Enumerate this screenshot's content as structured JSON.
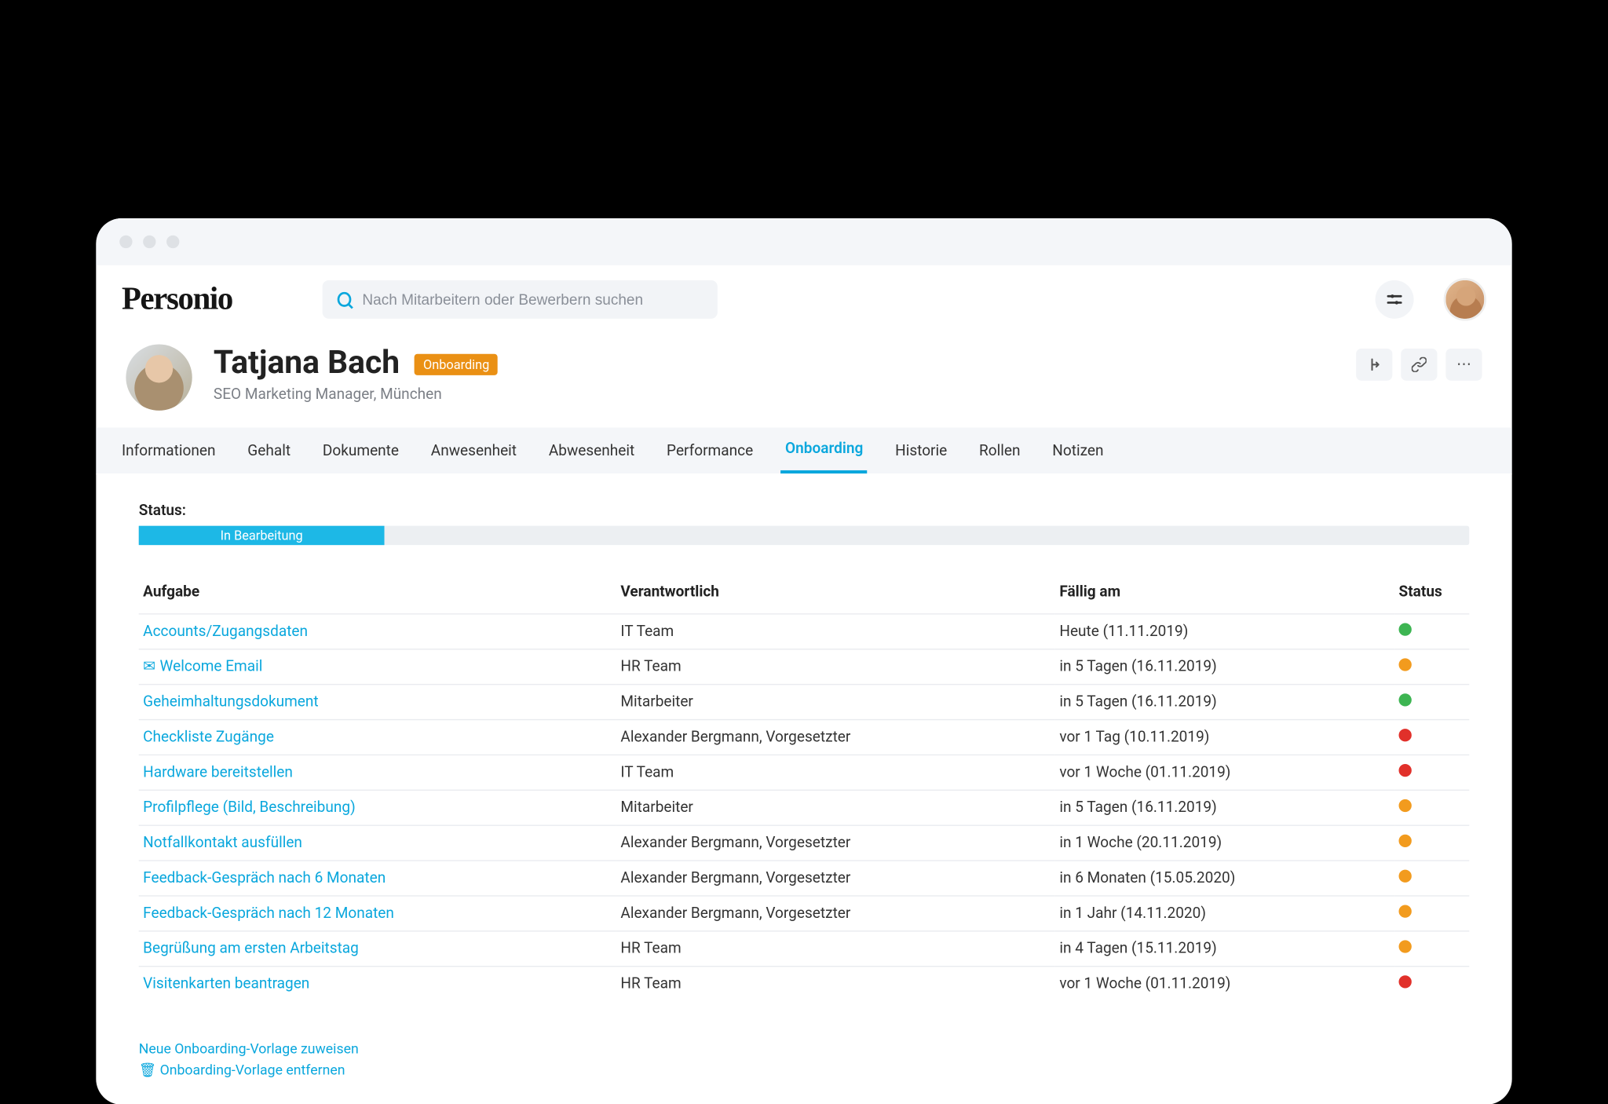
{
  "search": {
    "placeholder": "Nach Mitarbeitern oder Bewerbern suchen"
  },
  "profile": {
    "name": "Tatjana Bach",
    "badge": "Onboarding",
    "subtitle": "SEO Marketing Manager, München"
  },
  "tabs": [
    "Informationen",
    "Gehalt",
    "Dokumente",
    "Anwesenheit",
    "Abwesenheit",
    "Performance",
    "Onboarding",
    "Historie",
    "Rollen",
    "Notizen"
  ],
  "active_tab_index": 6,
  "status": {
    "label": "Status:",
    "text": "In Bearbeitung"
  },
  "table": {
    "headers": {
      "task": "Aufgabe",
      "responsible": "Verantwortlich",
      "due": "Fällig am",
      "status": "Status"
    },
    "rows": [
      {
        "task": "Accounts/Zugangsdaten",
        "icon": "",
        "responsible": "IT Team",
        "due": "Heute (11.11.2019)",
        "status": "green"
      },
      {
        "task": "Welcome Email",
        "icon": "mail",
        "responsible": "HR Team",
        "due": "in 5 Tagen (16.11.2019)",
        "status": "orange"
      },
      {
        "task": "Geheimhaltungsdokument",
        "icon": "",
        "responsible": "Mitarbeiter",
        "due": "in 5 Tagen (16.11.2019)",
        "status": "green"
      },
      {
        "task": "Checkliste Zugänge",
        "icon": "",
        "responsible": "Alexander Bergmann, Vorgesetzter",
        "due": "vor 1 Tag (10.11.2019)",
        "status": "red"
      },
      {
        "task": "Hardware bereitstellen",
        "icon": "",
        "responsible": "IT Team",
        "due": "vor 1 Woche (01.11.2019)",
        "status": "red"
      },
      {
        "task": "Profilpflege (Bild, Beschreibung)",
        "icon": "",
        "responsible": "Mitarbeiter",
        "due": "in 5 Tagen (16.11.2019)",
        "status": "orange"
      },
      {
        "task": "Notfallkontakt ausfüllen",
        "icon": "",
        "responsible": "Alexander Bergmann, Vorgesetzter",
        "due": "in 1 Woche (20.11.2019)",
        "status": "orange"
      },
      {
        "task": "Feedback-Gespräch nach 6 Monaten",
        "icon": "",
        "responsible": "Alexander Bergmann, Vorgesetzter",
        "due": "in 6 Monaten (15.05.2020)",
        "status": "orange"
      },
      {
        "task": "Feedback-Gespräch nach 12 Monaten",
        "icon": "",
        "responsible": "Alexander Bergmann, Vorgesetzter",
        "due": "in 1 Jahr (14.11.2020)",
        "status": "orange"
      },
      {
        "task": "Begrüßung am ersten Arbeitstag",
        "icon": "",
        "responsible": "HR Team",
        "due": "in 4 Tagen (15.11.2019)",
        "status": "orange"
      },
      {
        "task": "Visitenkarten beantragen",
        "icon": "",
        "responsible": "HR Team",
        "due": "vor 1 Woche (01.11.2019)",
        "status": "red"
      }
    ]
  },
  "bottom_links": {
    "assign": "Neue Onboarding-Vorlage zuweisen",
    "remove": "Onboarding-Vorlage entfernen"
  },
  "logo_text": "Personio"
}
